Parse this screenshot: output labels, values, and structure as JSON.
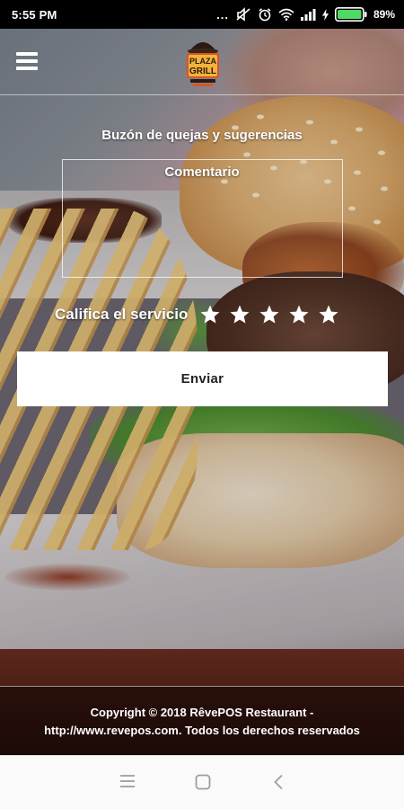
{
  "status_bar": {
    "time": "5:55 PM",
    "dots": "...",
    "battery_percent": "89%",
    "icons": [
      "notification-dots-icon",
      "mute-icon",
      "alarm-icon",
      "wifi-icon",
      "signal-icon",
      "battery-charging-icon"
    ]
  },
  "header": {
    "menu_icon": "hamburger-menu-icon",
    "logo_text_top": "PLAZA",
    "logo_text_bottom": "GRILL"
  },
  "form": {
    "title": "Buzón de quejas y sugerencias",
    "comment_placeholder": "Comentario",
    "rating_label": "Califica el servicio",
    "rating_value": 0,
    "rating_max": 5,
    "send_label": "Enviar"
  },
  "footer": {
    "line1": "Copyright © 2018 RêvePOS Restaurant -",
    "line2": "http://www.revepos.com. Todos los derechos reservados"
  },
  "nav_bar": {
    "icons": [
      "recent-apps-icon",
      "home-icon",
      "back-icon"
    ]
  },
  "colors": {
    "status_bar_bg": "#000000",
    "battery_green": "#4cd964",
    "button_bg": "#ffffff",
    "nav_bar_bg": "#fafafa",
    "nav_icon": "#9e9e9e"
  }
}
